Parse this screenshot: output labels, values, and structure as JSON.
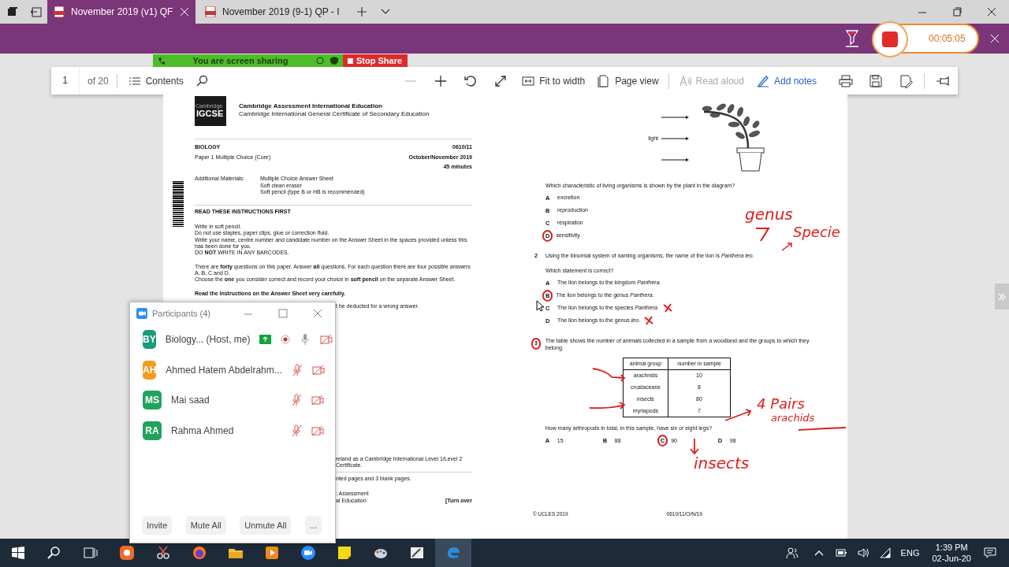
{
  "browser": {
    "tabs": [
      {
        "title": "November 2019 (v1) QF",
        "selected": true
      },
      {
        "title": "November 2019 (9-1) QP - I",
        "selected": false
      }
    ]
  },
  "recorder": {
    "time": "00:05:05"
  },
  "share_banner": {
    "status": "You are screen sharing",
    "stop_label": "Stop Share"
  },
  "toolbar": {
    "page": "1",
    "page_count": "of 20",
    "contents": "Contents",
    "fit": "Fit to width",
    "page_view": "Page view",
    "read_aloud": {
      "label": "Read aloud",
      "disabled": true
    },
    "add_notes": "Add notes"
  },
  "left_page": {
    "logo": {
      "top": "Cambridge",
      "bottom": "IGCSE"
    },
    "org": [
      "Cambridge Assessment International Education",
      "Cambridge International General Certificate of Secondary Education"
    ],
    "subject": "BIOLOGY",
    "code": "0610/11",
    "paper": "Paper 1  Multiple Choice (Core)",
    "session": "October/November 2019",
    "duration": "45 minutes",
    "materials_label": "Additional Materials:",
    "materials": [
      "Multiple Choice Answer Sheet",
      "Soft clean eraser",
      "Soft pencil (type B or HB is recommended)"
    ],
    "instructions_heading": "READ THESE INSTRUCTIONS FIRST",
    "instructions": [
      "Write in soft pencil.\nDo not use staples, paper clips, glue or correction fluid.\nWrite your name, centre number and candidate number on the Answer Sheet in the spaces provided unless this has been done for you.\nDO **NOT** WRITE IN ANY BARCODES.",
      "There are **forty** questions on this paper. Answer **all** questions. For each question there are four possible answers A, B, C and D.\nChoose the **one** you consider correct and record your choice in **soft pencil** on the separate Answer Sheet.",
      "**Read the instructions on the Answer Sheet very carefully.**"
    ],
    "partial_line": "t be deducted for a wrong answer.",
    "footer": {
      "note": "reland as a Cambridge International Level 1/Level 2 Certificate.",
      "pages": "nted pages and 3 blank pages.",
      "org": [
        ": Assessment",
        "al Education"
      ],
      "turn_over": "[Turn over"
    }
  },
  "right_page": {
    "questions": [
      {
        "diagram": {
          "label": "light"
        },
        "text": "Which characteristic of living organisms is shown by the plant in the diagram?",
        "options_inline": false,
        "options": [
          {
            "letter": "A",
            "text": "excretion",
            "circled": false,
            "crossed": false
          },
          {
            "letter": "B",
            "text": "reproduction",
            "circled": false,
            "crossed": false
          },
          {
            "letter": "C",
            "text": "respiration",
            "circled": false,
            "crossed": false
          },
          {
            "letter": "D",
            "text": "sensitivity",
            "circled": true,
            "crossed": false
          }
        ]
      },
      {
        "number": "2",
        "number_circled": false,
        "text": "Using the binomial system of naming organisms, the name of the lion is *Panthera leo*.",
        "prompt": "Which statement is correct?",
        "options_inline": false,
        "options": [
          {
            "letter": "A",
            "text": "The lion belongs to the kingdom *Panthera*.",
            "circled": false,
            "crossed": false
          },
          {
            "letter": "B",
            "text": "The lion belongs to the genus *Panthera*.",
            "circled": true,
            "crossed": false
          },
          {
            "letter": "C",
            "text": "The lion belongs to the species *Panthera*.",
            "circled": false,
            "crossed": true
          },
          {
            "letter": "D",
            "text": "The lion belongs to the genus *leo*.",
            "circled": false,
            "crossed": true
          }
        ]
      },
      {
        "number": "3",
        "number_circled": true,
        "text": "The table shows the number of animals collected in a sample from a woodland and the groups to which they belong.",
        "table": {
          "columns": [
            "animal group",
            "number in sample"
          ],
          "rows": [
            [
              "arachnids",
              "10"
            ],
            [
              "crustaceans",
              "8"
            ],
            [
              "insects",
              "80"
            ],
            [
              "myriapods",
              "7"
            ]
          ]
        },
        "prompt": "How many arthropods in total, in this sample, have six or eight legs?",
        "options_inline": true,
        "options": [
          {
            "letter": "A",
            "text": "15",
            "circled": false,
            "crossed": false
          },
          {
            "letter": "B",
            "text": "88",
            "circled": false,
            "crossed": false
          },
          {
            "letter": "C",
            "text": "90",
            "circled": true,
            "crossed": false
          },
          {
            "letter": "D",
            "text": "98",
            "circled": false,
            "crossed": false
          }
        ]
      }
    ],
    "footer": {
      "copyright": "© UCLES 2019",
      "ref": "0610/11/O/N/19"
    },
    "annotations": [
      {
        "text": "genus"
      },
      {
        "text": "Specie"
      },
      {
        "text": "4 Pairs"
      },
      {
        "text": "arachids"
      },
      {
        "text": "insects"
      }
    ]
  },
  "participants": {
    "title": "Participants (4)",
    "people": [
      {
        "initials": "BY",
        "name": "Biology... (Host, me)",
        "color": "#1b9a7c",
        "sharing": true,
        "recording": true,
        "muted": false
      },
      {
        "initials": "AH",
        "name": "Ahmed Hatem Abdelrahm...",
        "color": "#f29b1d",
        "sharing": false,
        "recording": false,
        "muted": true
      },
      {
        "initials": "MS",
        "name": "Mai saad",
        "color": "#22a35c",
        "sharing": false,
        "recording": false,
        "muted": true
      },
      {
        "initials": "RA",
        "name": "Rahma Ahmed",
        "color": "#22a35c",
        "sharing": false,
        "recording": false,
        "muted": true
      }
    ],
    "buttons": [
      "Invite",
      "Mute All",
      "Unmute All",
      "..."
    ]
  },
  "taskbar": {
    "language": "ENG",
    "time": "1:39 PM",
    "date": "02-Jun-20"
  }
}
